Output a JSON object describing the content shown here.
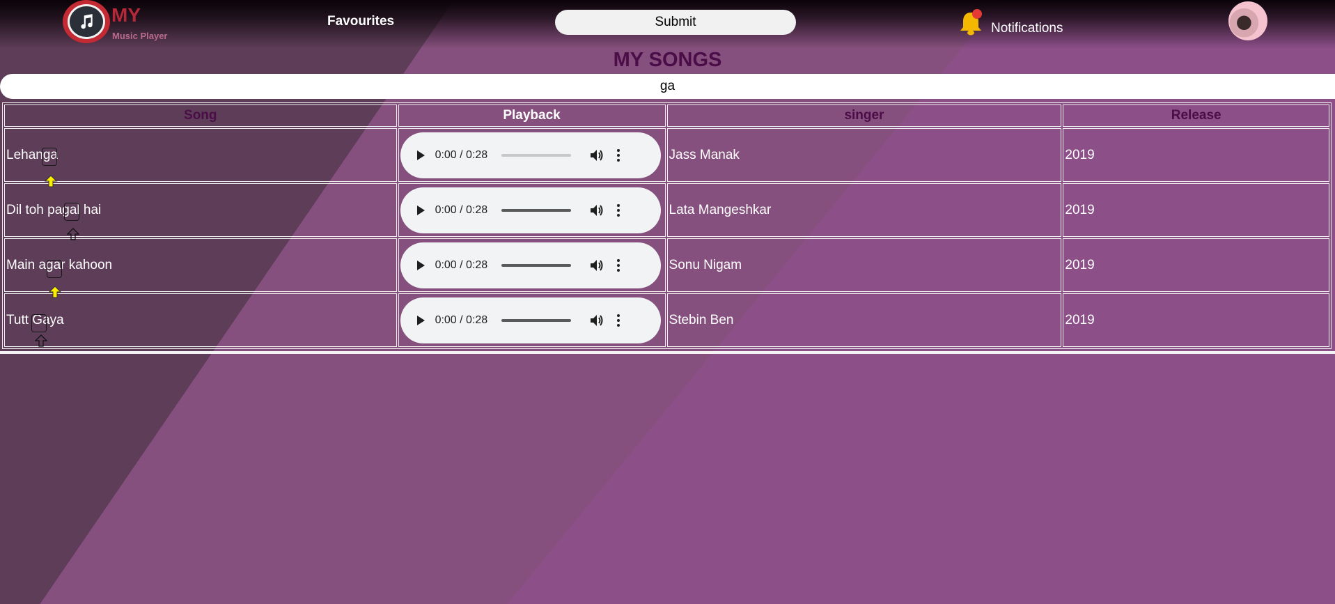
{
  "header": {
    "logo_title": "MY",
    "logo_subtitle": "Music Player",
    "favourites_label": "Favourites",
    "submit_label": "Submit",
    "notifications_label": "Notifications"
  },
  "page_title": "MY SONGS",
  "search": {
    "value": "ga"
  },
  "table": {
    "headers": {
      "song": "Song",
      "playback": "Playback",
      "singer": "singer",
      "release": "Release"
    },
    "rows": [
      {
        "song": "Lehanga",
        "time": "0:00 / 0:28",
        "singer": "Jass Manak",
        "release": "2019"
      },
      {
        "song": "Dil toh pagal hai",
        "time": "0:00 / 0:28",
        "singer": "Lata Mangeshkar",
        "release": "2019"
      },
      {
        "song": "Main agar kahoon",
        "time": "0:00 / 0:28",
        "singer": "Sonu Nigam",
        "release": "2019"
      },
      {
        "song": "Tutt Gaya",
        "time": "0:00 / 0:28",
        "singer": "Stebin Ben",
        "release": "2019"
      }
    ]
  },
  "colors": {
    "accent_red": "#c42a33",
    "title_purple": "#4a0d47",
    "bell_yellow": "#f5b800",
    "bell_badge": "#e53935"
  },
  "icons": [
    "music-note-icon",
    "bell-icon",
    "play-icon",
    "volume-icon",
    "more-options-icon",
    "cursor-arrow-icon"
  ]
}
